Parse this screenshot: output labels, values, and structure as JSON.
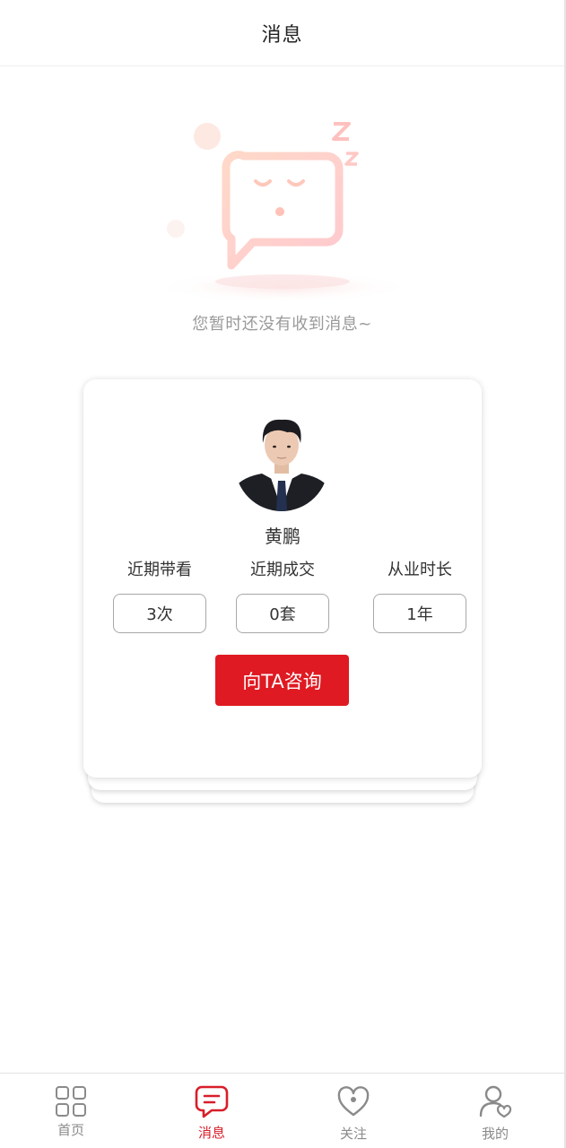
{
  "header": {
    "title": "消息"
  },
  "empty_state": {
    "text": "您暂时还没有收到消息~",
    "icon": "sleeping-chat-bubble-icon"
  },
  "agent": {
    "name": "黄鹏",
    "stats": [
      {
        "label": "近期带看",
        "value": "3次"
      },
      {
        "label": "近期成交",
        "value": "0套"
      },
      {
        "label": "从业时长",
        "value": "1年"
      }
    ],
    "consult_button": "向TA咨询"
  },
  "tabbar": {
    "active": "消息",
    "items": [
      {
        "label": "首页",
        "icon": "grid-icon"
      },
      {
        "label": "消息",
        "icon": "message-icon"
      },
      {
        "label": "关注",
        "icon": "heart-icon"
      },
      {
        "label": "我的",
        "icon": "user-heart-icon"
      }
    ]
  },
  "colors": {
    "accent": "#df1a22",
    "tab_active": "#d81e2a",
    "muted_text": "#9a9a9a"
  }
}
